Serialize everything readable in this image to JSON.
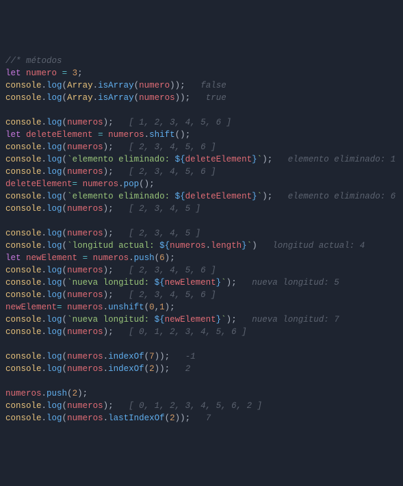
{
  "code": {
    "l1": {
      "comment": "//* métodos"
    },
    "l2": {
      "kw": "let",
      "vr": "numero",
      "eq": "=",
      "num": "3",
      ";": ";"
    },
    "l3": {
      "obj": "console",
      "dot": ".",
      "fn": "log",
      "op": "(",
      "cls": "Array",
      "dot2": ".",
      "m": "isArray",
      "op2": "(",
      "arg": "numero",
      "cp": ")",
      "cp2": ")",
      ";": ";",
      "sp": "   ",
      "c": "false"
    },
    "l4": {
      "obj": "console",
      "dot": ".",
      "fn": "log",
      "op": "(",
      "cls": "Array",
      "dot2": ".",
      "m": "isArray",
      "op2": "(",
      "arg": "numeros",
      "cp": ")",
      "cp2": ")",
      ";": ";",
      "sp": "   ",
      "c": "true"
    },
    "l6": {
      "obj": "console",
      "dot": ".",
      "fn": "log",
      "op": "(",
      "arg": "numeros",
      "cp": ")",
      ";": ";",
      "sp": "   ",
      "c": "[ 1, 2, 3, 4, 5, 6 ]"
    },
    "l7": {
      "kw": "let",
      "vr": "deleteElement",
      "eq": "=",
      "arg": "numeros",
      "dot": ".",
      "fn": "shift",
      "op": "(",
      "cp": ")",
      ";": ";"
    },
    "l8": {
      "obj": "console",
      "dot": ".",
      "fn": "log",
      "op": "(",
      "arg": "numeros",
      "cp": ")",
      ";": ";",
      "sp": "   ",
      "c": "[ 2, 3, 4, 5, 6 ]"
    },
    "l9": {
      "obj": "console",
      "dot": ".",
      "fn": "log",
      "op": "(",
      "bt": "`",
      "s1": "elemento eliminado: ",
      "db": "${",
      "sv": "deleteElement",
      "de": "}",
      "bt2": "`",
      "cp": ")",
      ";": ";",
      "sp": "   ",
      "c": "elemento eliminado: 1"
    },
    "l10": {
      "obj": "console",
      "dot": ".",
      "fn": "log",
      "op": "(",
      "arg": "numeros",
      "cp": ")",
      ";": ";",
      "sp": "   ",
      "c": "[ 2, 3, 4, 5, 6 ]"
    },
    "l11": {
      "vr": "deleteElement",
      "eq": "=",
      "arg": "numeros",
      "dot": ".",
      "fn": "pop",
      "op": "(",
      "cp": ")",
      ";": ";"
    },
    "l12": {
      "obj": "console",
      "dot": ".",
      "fn": "log",
      "op": "(",
      "bt": "`",
      "s1": "elemento eliminado: ",
      "db": "${",
      "sv": "deleteElement",
      "de": "}",
      "bt2": "`",
      "cp": ")",
      ";": ";",
      "sp": "   ",
      "c": "elemento eliminado: 6"
    },
    "l13": {
      "obj": "console",
      "dot": ".",
      "fn": "log",
      "op": "(",
      "arg": "numeros",
      "cp": ")",
      ";": ";",
      "sp": "   ",
      "c": "[ 2, 3, 4, 5 ]"
    },
    "l15": {
      "obj": "console",
      "dot": ".",
      "fn": "log",
      "op": "(",
      "arg": "numeros",
      "cp": ")",
      ";": ";",
      "sp": "   ",
      "c": "[ 2, 3, 4, 5 ]"
    },
    "l16": {
      "obj": "console",
      "dot": ".",
      "fn": "log",
      "op": "(",
      "bt": "`",
      "s1": "longitud actual: ",
      "db": "${",
      "sv": "numeros",
      "sdot": ".",
      "sprop": "length",
      "de": "}",
      "bt2": "`",
      "cp": ")",
      "sp": "   ",
      "c": "longitud actual: 4"
    },
    "l17": {
      "kw": "let",
      "vr": "newElement",
      "eq": "=",
      "arg": "numeros",
      "dot": ".",
      "fn": "push",
      "op": "(",
      "narg": "6",
      "cp": ")",
      ";": ";"
    },
    "l18": {
      "obj": "console",
      "dot": ".",
      "fn": "log",
      "op": "(",
      "arg": "numeros",
      "cp": ")",
      ";": ";",
      "sp": "   ",
      "c": "[ 2, 3, 4, 5, 6 ]"
    },
    "l19": {
      "obj": "console",
      "dot": ".",
      "fn": "log",
      "op": "(",
      "bt": "`",
      "s1": "nueva longitud: ",
      "db": "${",
      "sv": "newElement",
      "de": "}",
      "bt2": "`",
      "cp": ")",
      ";": ";",
      "sp": "   ",
      "c": "nueva longitud: 5"
    },
    "l20": {
      "obj": "console",
      "dot": ".",
      "fn": "log",
      "op": "(",
      "arg": "numeros",
      "cp": ")",
      ";": ";",
      "sp": "   ",
      "c": "[ 2, 3, 4, 5, 6 ]"
    },
    "l21": {
      "vr": "newElement",
      "eq": "=",
      "arg": "numeros",
      "dot": ".",
      "fn": "unshift",
      "op": "(",
      "n1": "0",
      "cm": ",",
      "n2": "1",
      "cp": ")",
      ";": ";"
    },
    "l22": {
      "obj": "console",
      "dot": ".",
      "fn": "log",
      "op": "(",
      "bt": "`",
      "s1": "nueva longitud: ",
      "db": "${",
      "sv": "newElement",
      "de": "}",
      "bt2": "`",
      "cp": ")",
      ";": ";",
      "sp": "   ",
      "c": "nueva longitud: 7"
    },
    "l23": {
      "obj": "console",
      "dot": ".",
      "fn": "log",
      "op": "(",
      "arg": "numeros",
      "cp": ")",
      ";": ";",
      "sp": "   ",
      "c": "[ 0, 1, 2, 3, 4, 5, 6 ]"
    },
    "l25": {
      "obj": "console",
      "dot": ".",
      "fn": "log",
      "op": "(",
      "arg": "numeros",
      "dot2": ".",
      "fn2": "indexOf",
      "op2": "(",
      "narg": "7",
      "cp": ")",
      "cp2": ")",
      ";": ";",
      "sp": "   ",
      "c": "-1"
    },
    "l26": {
      "obj": "console",
      "dot": ".",
      "fn": "log",
      "op": "(",
      "arg": "numeros",
      "dot2": ".",
      "fn2": "indexOf",
      "op2": "(",
      "narg": "2",
      "cp": ")",
      "cp2": ")",
      ";": ";",
      "sp": "   ",
      "c": "2"
    },
    "l28": {
      "arg": "numeros",
      "dot": ".",
      "fn": "push",
      "op": "(",
      "narg": "2",
      "cp": ")",
      ";": ";"
    },
    "l29": {
      "obj": "console",
      "dot": ".",
      "fn": "log",
      "op": "(",
      "arg": "numeros",
      "cp": ")",
      ";": ";",
      "sp": "   ",
      "c": "[ 0, 1, 2, 3, 4, 5, 6, 2 ]"
    },
    "l30": {
      "obj": "console",
      "dot": ".",
      "fn": "log",
      "op": "(",
      "arg": "numeros",
      "dot2": ".",
      "fn2": "lastIndexOf",
      "op2": "(",
      "narg": "2",
      "cp": ")",
      "cp2": ")",
      ";": ";",
      "sp": "   ",
      "c": "7"
    }
  }
}
